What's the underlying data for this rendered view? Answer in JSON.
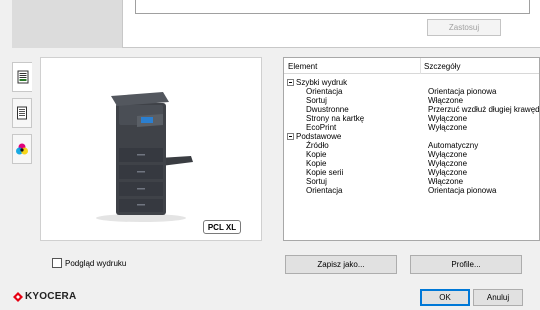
{
  "toolbar": {
    "apply_label": "Zastosuj"
  },
  "preview": {
    "badge": "PCL XL",
    "show_preview_label": "Podgląd wydruku"
  },
  "side_tabs": [
    {
      "icon": "printer-settings-icon",
      "active": true
    },
    {
      "icon": "document-icon",
      "active": false
    },
    {
      "icon": "color-icon",
      "active": false
    }
  ],
  "grid": {
    "col_element": "Element",
    "col_details": "Szczegóły",
    "rows": [
      {
        "group": true,
        "name": "Szybki wydruk"
      },
      {
        "name": "Orientacja",
        "value": "Orientacja pionowa"
      },
      {
        "name": "Sortuj",
        "value": "Włączone"
      },
      {
        "name": "Dwustronne",
        "value": "Przerzuć wzdłuż długiej krawędzi"
      },
      {
        "name": "Strony na kartkę",
        "value": "Wyłączone"
      },
      {
        "name": "EcoPrint",
        "value": "Wyłączone"
      },
      {
        "group": true,
        "name": "Podstawowe"
      },
      {
        "name": "Źródło",
        "value": "Automatyczny"
      },
      {
        "name": "Kopie",
        "value": "Wyłączone"
      },
      {
        "name": "Kopie",
        "value": "Wyłączone"
      },
      {
        "name": "Kopie serii",
        "value": "Wyłączone"
      },
      {
        "name": "Sortuj",
        "value": "Włączone"
      },
      {
        "name": "Orientacja",
        "value": "Orientacja pionowa"
      }
    ]
  },
  "buttons": {
    "save_as": "Zapisz jako...",
    "profile": "Profile...",
    "ok": "OK",
    "cancel": "Anuluj"
  },
  "brand": {
    "name": "KYOCERA",
    "color": "#e60012"
  }
}
